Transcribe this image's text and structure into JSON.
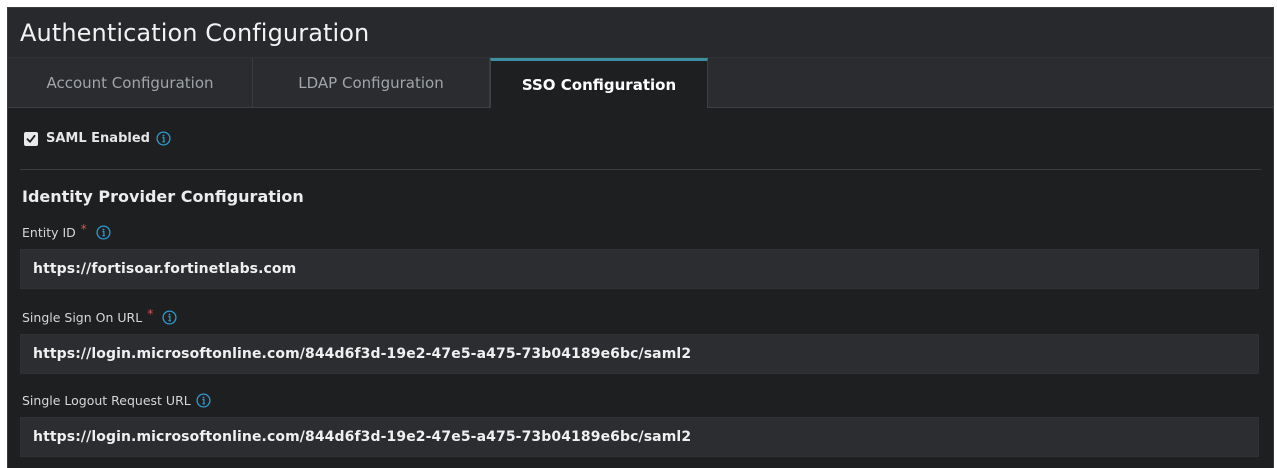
{
  "header": {
    "title": "Authentication Configuration"
  },
  "tabs": [
    {
      "label": "Account Configuration",
      "active": false
    },
    {
      "label": "LDAP Configuration",
      "active": false
    },
    {
      "label": "SSO Configuration",
      "active": true
    }
  ],
  "saml": {
    "label": "SAML Enabled",
    "checked": true
  },
  "section": {
    "title": "Identity Provider Configuration"
  },
  "fields": [
    {
      "label": "Entity ID",
      "required": true,
      "required_mark": "*",
      "value": "https://fortisoar.fortinetlabs.com"
    },
    {
      "label": "Single Sign On URL",
      "required": true,
      "required_mark": "*",
      "value": "https://login.microsoftonline.com/844d6f3d-19e2-47e5-a475-73b04189e6bc/saml2"
    },
    {
      "label": "Single Logout Request URL",
      "required": false,
      "value": "https://login.microsoftonline.com/844d6f3d-19e2-47e5-a475-73b04189e6bc/saml2"
    }
  ],
  "colors": {
    "accent": "#3f8fa3",
    "info_icon": "#2e9ad0",
    "required": "#d9534f",
    "background": "#1e1f21"
  },
  "icons": {
    "checkbox": "checkmark-icon",
    "info": "info-circle-icon"
  }
}
